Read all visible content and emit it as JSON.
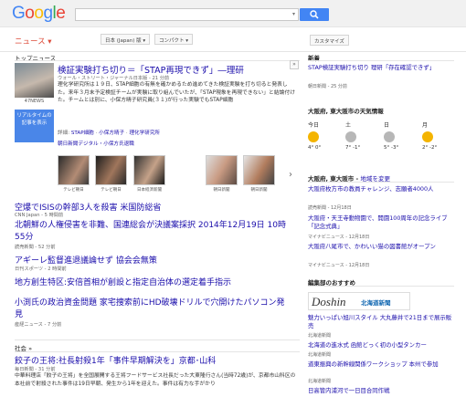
{
  "logo": "Google",
  "search": {
    "value": "",
    "dropdown_icon": "chevron-down-icon"
  },
  "nav": {
    "section_label": "ニュース",
    "edition_label": "日本 (Japan) 版",
    "compact_label": "コンパクト",
    "customize_label": "カスタマイズ"
  },
  "top_news": {
    "header": "トップニュース",
    "feature": {
      "headline": "検証実験打ち切り＝「STAP再現できず」―理研",
      "source": "ウォール・ストリート・ジャーナル日本版 - 21 分前",
      "snippet": "理化学研究所は１９日、STAP細胞の有無を確かめるため進めてきた検証実験を打ち切ると発表した。来年３月末予定検証チームが実験に取り組んでいたが、「STAP現象を再現できない」と結論付けた。チームとは別に、小保方晴子研究員(３１)が行った実験でもSTAP細胞",
      "image_caption": "47NEWS",
      "realtime_button": "リアルタイムの記事を表示",
      "related_label": "詳細:",
      "related_links": [
        "STAP細胞",
        "小保方晴子",
        "理化学研究所"
      ],
      "related2": "朝日新聞デジタル・小保方氏退職",
      "thumb_captions": [
        "テレビ朝日",
        "テレビ朝日",
        "日本経済新聞",
        "朝日新聞",
        "朝日新聞"
      ]
    },
    "stories": [
      {
        "headline": "空爆でISISの幹部3人を殺害 米国防総省",
        "meta": "CNN Japan - 5 時間前"
      },
      {
        "headline": "北朝鮮の人権侵害を非難、国連総会が決議案採択 2014年12月19日 10時55分",
        "meta": "読売新聞 - 52 分前"
      },
      {
        "headline": "アギーレ監督進退議論せず 協会会無策",
        "meta": "日刊スポーツ - 2 時間前"
      },
      {
        "headline": "地方創生特区:安倍首相が創設と指定自治体の選定着手指示",
        "meta": ""
      },
      {
        "headline": "小渕氏の政治資金問題 家宅捜索前にHD破壊ドリルで穴開けたパソコン発見",
        "meta": "産経ニュース - 7 分前"
      }
    ]
  },
  "society": {
    "header": "社会",
    "story": {
      "headline": "餃子の王将:社長射殺1年「事件早期解決を」京都･山科",
      "meta": "毎日新聞 - 31 分前",
      "snippet": "中華料理店「餃子の王将」を全国展開する王将フードサービス社長だった大東隆行さん(当時72歳)が、京都市山科区の本社前で射殺された事件は19日早朝、発生から1年を迎えた。事件は有力な手がかり"
    }
  },
  "sidebar": {
    "latest_header": "新着",
    "latest_links": [
      "STAP検証実験打ち切り 理研「存在確認できず」"
    ],
    "latest_meta": "朝日新聞 - 25 分前",
    "weather_header": "大阪府, 東大阪市の天気情報",
    "weather_days": [
      {
        "day": "今日",
        "icon": "sun",
        "temp": "4° 0°"
      },
      {
        "day": "土",
        "icon": "cloud",
        "temp": "7° -1°"
      },
      {
        "day": "日",
        "icon": "cloud",
        "temp": "5° -3°"
      },
      {
        "day": "月",
        "icon": "sun",
        "temp": "2° -2°"
      }
    ],
    "local_header": "大阪府, 東大阪市",
    "local_link_edit": "地域を変更",
    "local_items": [
      {
        "link": "大阪府枚方市の教員チャレンジ、志願者4000人",
        "meta": "読売新聞 - 12月18日"
      },
      {
        "link": "大阪府・天王寺動物園で、開園100周年の記念ライブ「記念式典」",
        "meta": "マイナビニュース - 12月18日"
      },
      {
        "link": "大阪府八尾市で、かわいい猫の図書館がオープン",
        "meta": "マイナビニュース - 12月18日"
      }
    ],
    "editor_header": "編集部のおすすめ",
    "editor_logo": "Doshin",
    "editor_logo_sub": "北海道新聞",
    "editor_items": [
      {
        "link": "魅力いっぱい旭川スタイル 大丸藤井で21日まで展示販売",
        "meta": "北海道新聞"
      },
      {
        "link": "北海道の進水式 函館どっく初の小型タンカー",
        "meta": "北海道新聞"
      },
      {
        "link": "道東振興の新幹線関係ワークショップ 本州で参加",
        "meta": "北海道新聞"
      },
      {
        "link": "日高管内浦河で一日目合同作戦",
        "meta": ""
      }
    ]
  }
}
